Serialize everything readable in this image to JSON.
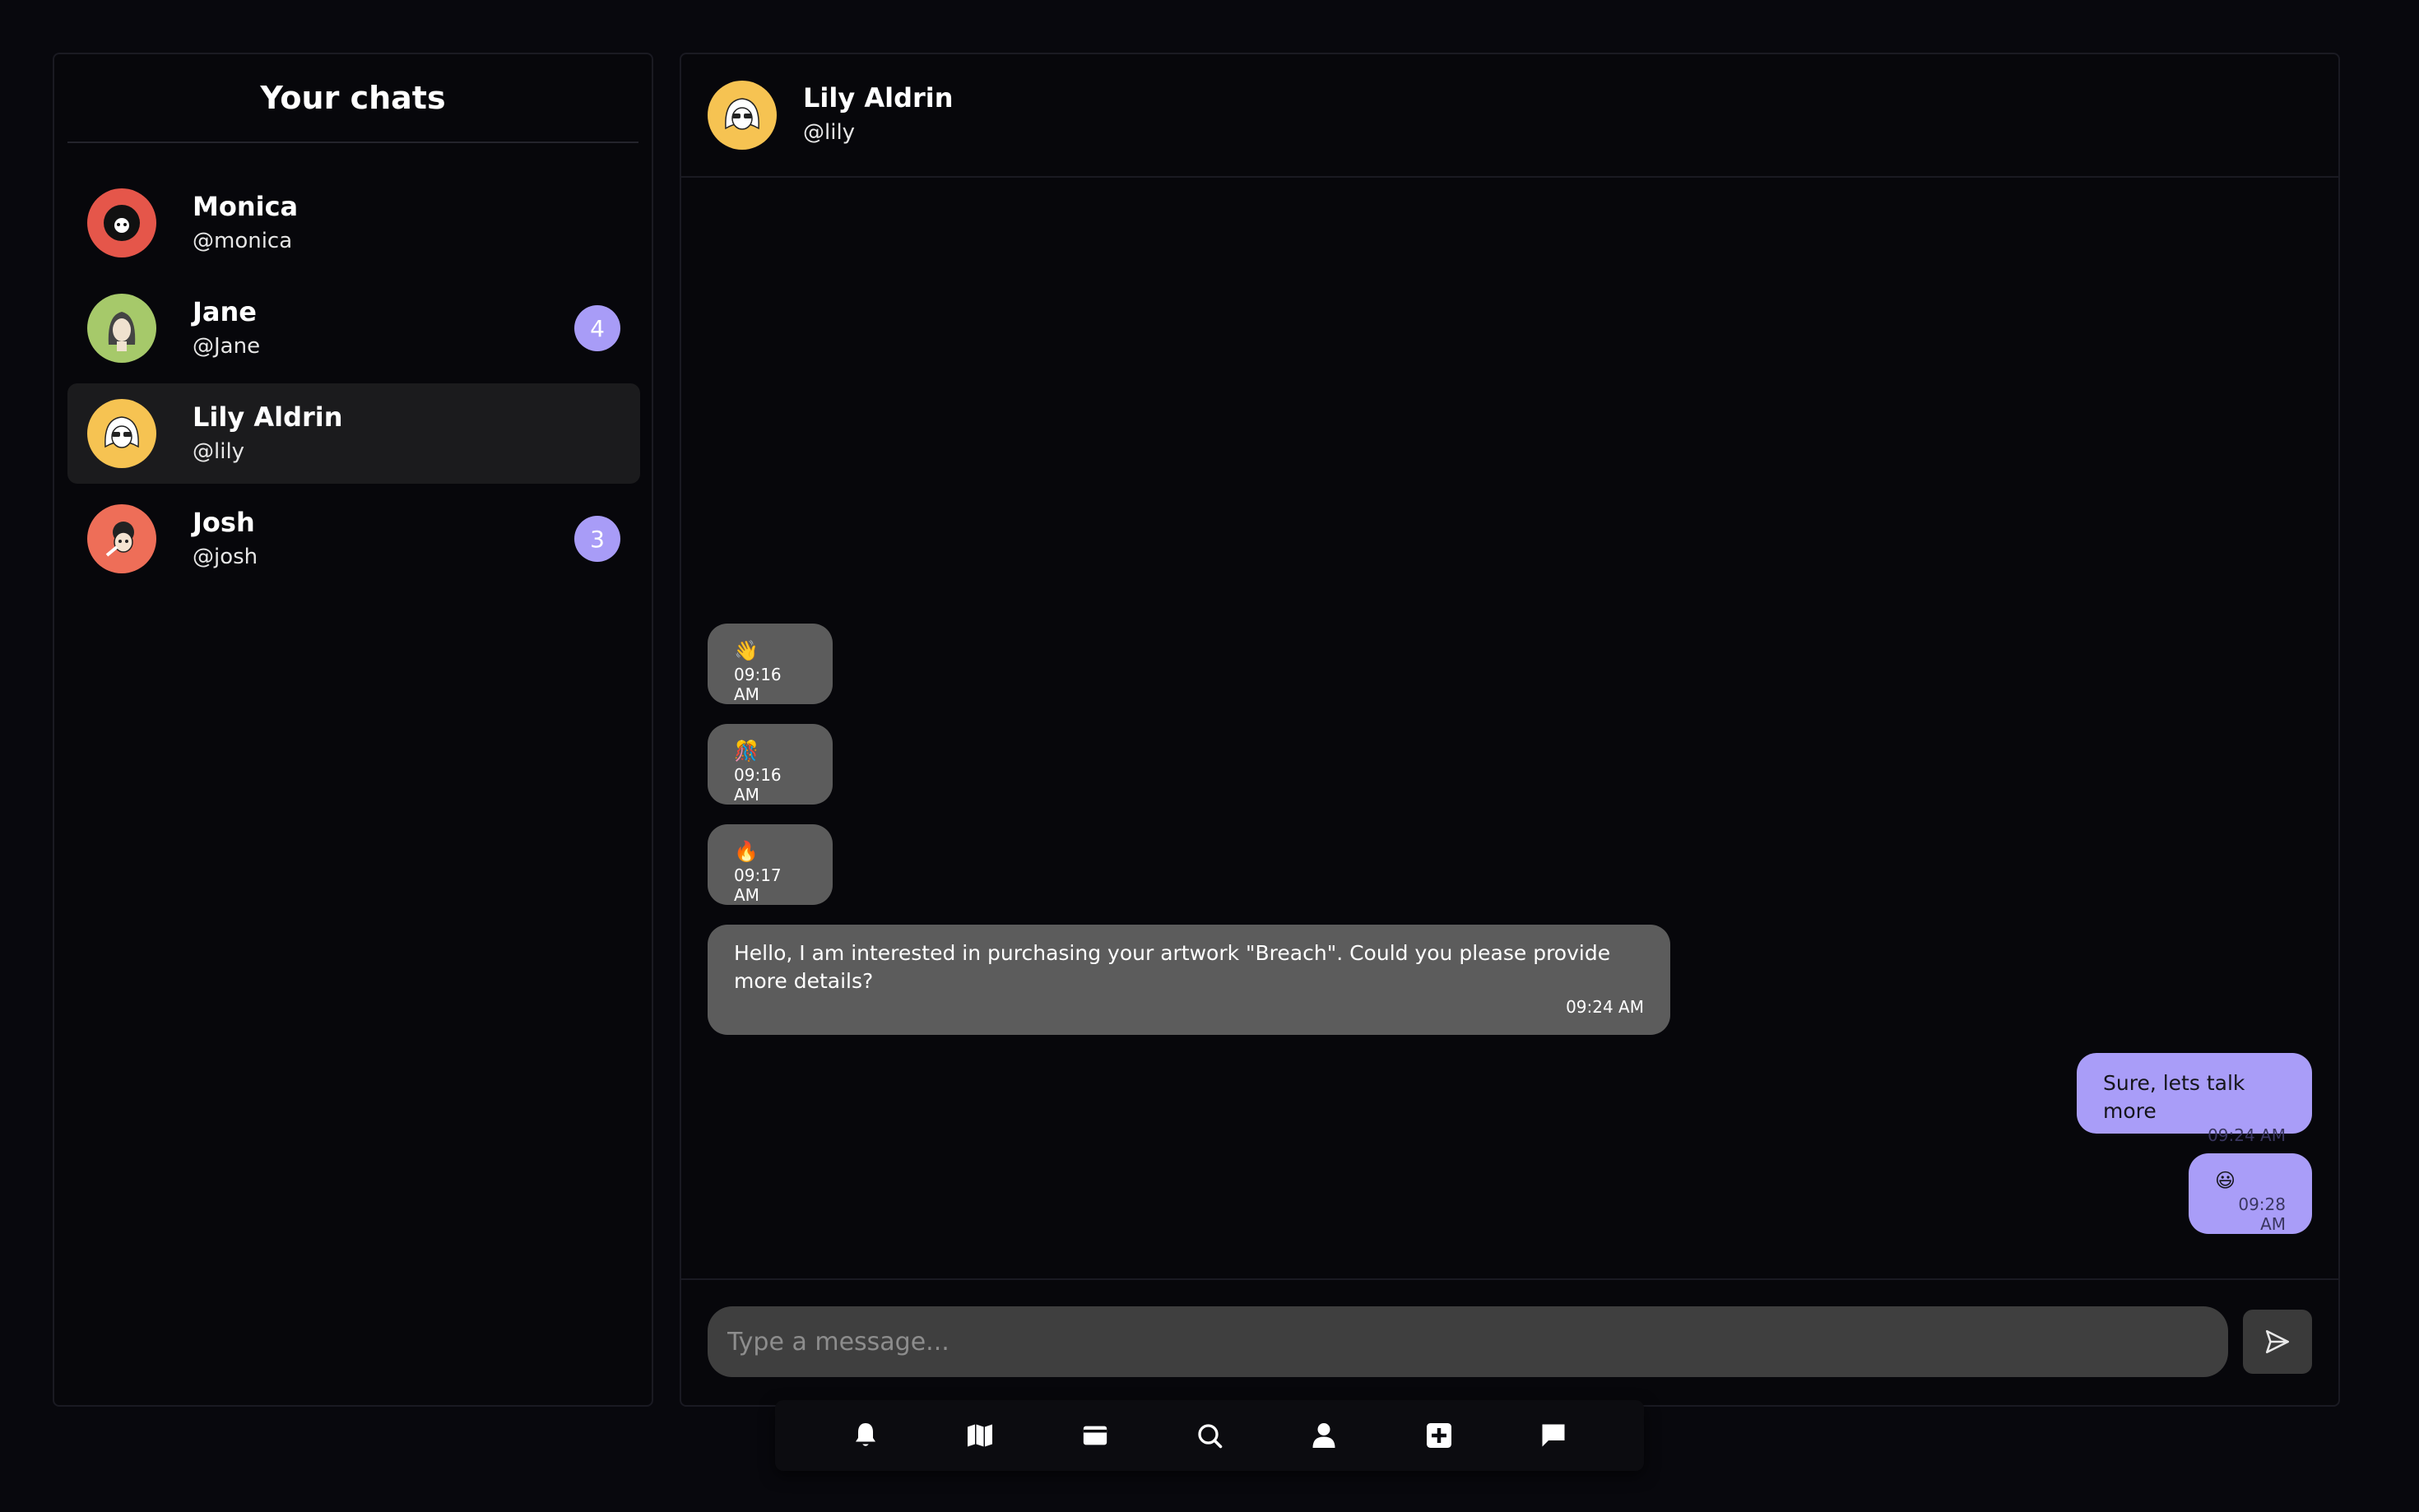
{
  "sidebar": {
    "title": "Your chats",
    "contacts": [
      {
        "name": "Monica",
        "handle": "@monica",
        "badge": "",
        "avatar_color": "#e5564a"
      },
      {
        "name": "Jane",
        "handle": "@Jane",
        "badge": "4",
        "avatar_color": "#a6c96a"
      },
      {
        "name": "Lily Aldrin",
        "handle": "@lily",
        "badge": "",
        "avatar_color": "#f6c352",
        "active": true
      },
      {
        "name": "Josh",
        "handle": "@josh",
        "badge": "3",
        "avatar_color": "#ee6e58"
      }
    ]
  },
  "chat": {
    "header": {
      "name": "Lily Aldrin",
      "handle": "@lily",
      "avatar_color": "#f6c352"
    },
    "messages": [
      {
        "direction": "in",
        "text": "👋",
        "time": "09:16 AM"
      },
      {
        "direction": "in",
        "text": "🎊",
        "time": "09:16 AM"
      },
      {
        "direction": "in",
        "text": "🔥",
        "time": "09:17 AM"
      },
      {
        "direction": "in",
        "text": "Hello, I am interested in purchasing your artwork \"Breach\". Could you please provide more details?",
        "time": "09:24 AM"
      },
      {
        "direction": "out",
        "text": "Sure, lets talk more",
        "time": "09:24 AM"
      },
      {
        "direction": "out",
        "text": "😃",
        "time": "09:28 AM"
      }
    ],
    "composer": {
      "placeholder": "Type a message..."
    }
  },
  "nav": {
    "items": [
      "bell-icon",
      "map-icon",
      "wallet-icon",
      "search-icon",
      "user-icon",
      "add-square-icon",
      "chat-icon"
    ]
  },
  "colors": {
    "accent": "#a99df8",
    "incoming_bubble": "#5c5c5c",
    "background": "#08080d"
  }
}
